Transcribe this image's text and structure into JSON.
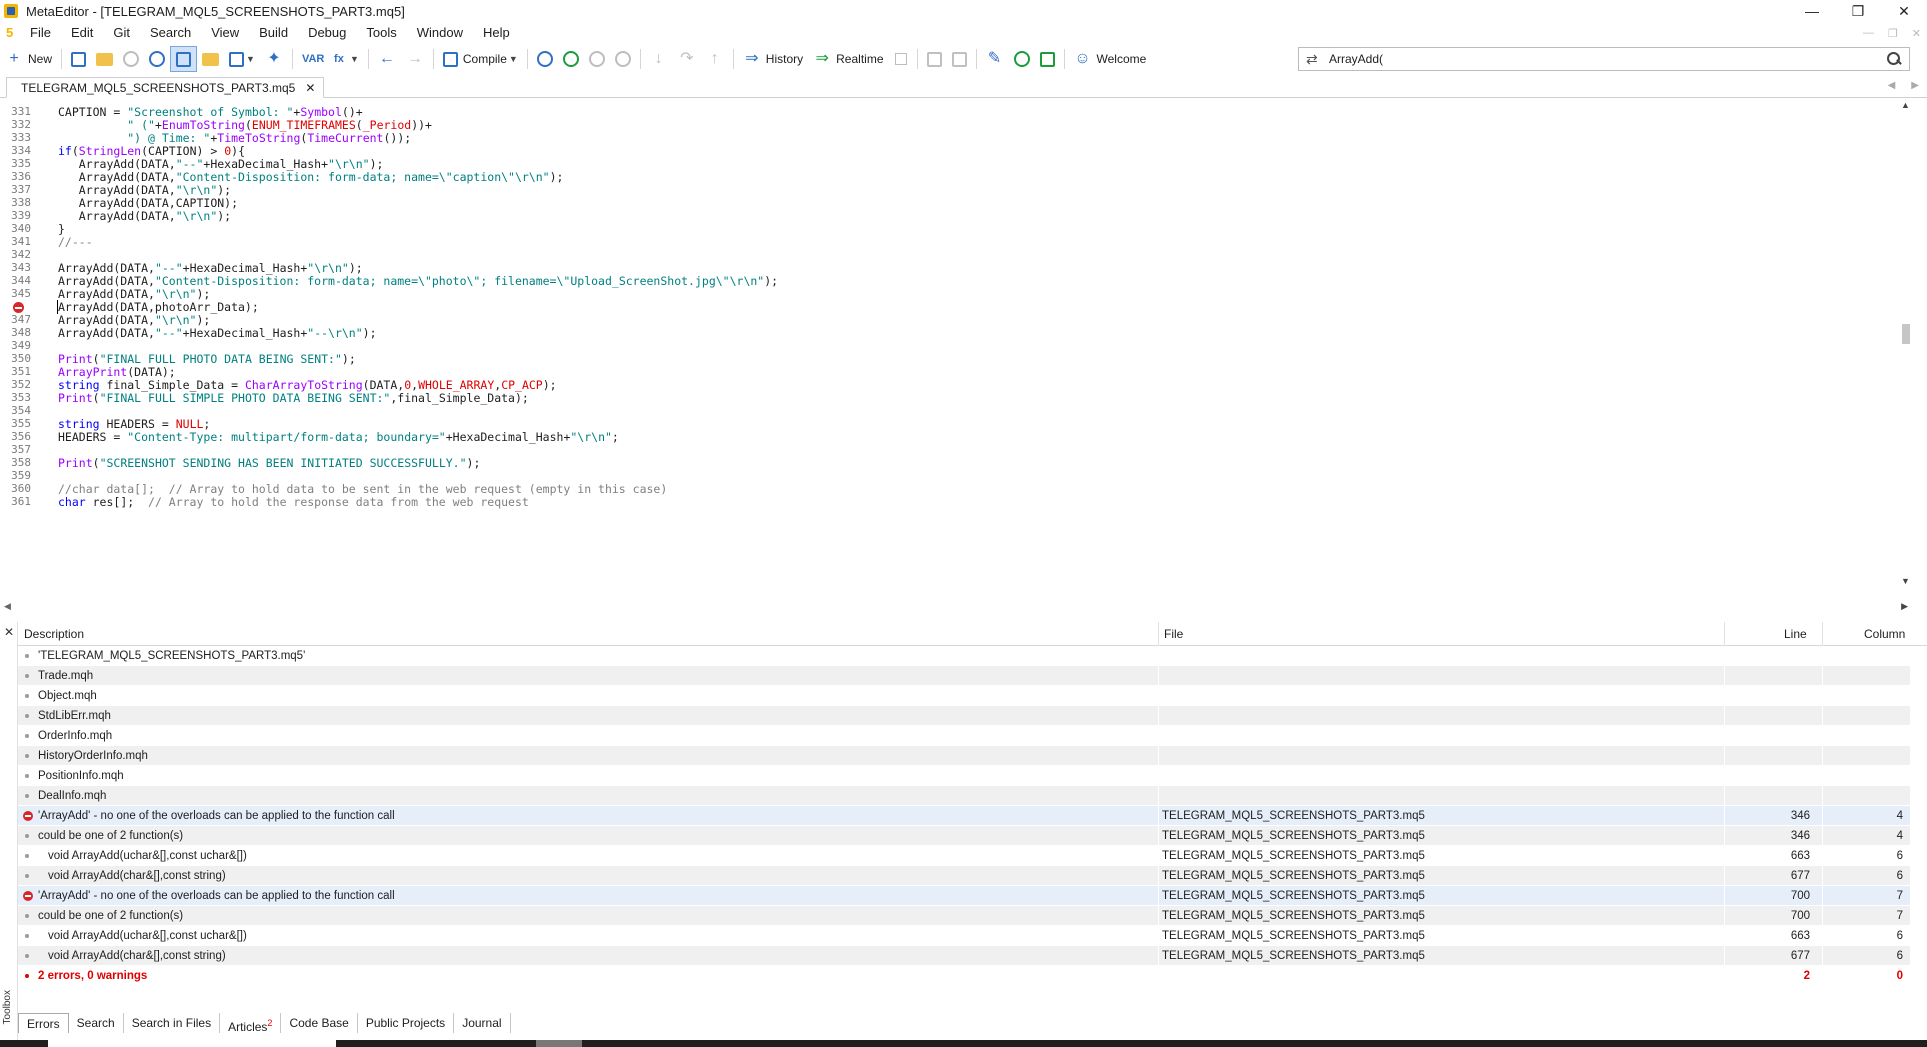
{
  "window": {
    "title": "MetaEditor - [TELEGRAM_MQL5_SCREENSHOTS_PART3.mq5]",
    "minimize": "—",
    "maximize": "❐",
    "close": "✕"
  },
  "menu": [
    "File",
    "Edit",
    "Git",
    "Search",
    "View",
    "Build",
    "Debug",
    "Tools",
    "Window",
    "Help"
  ],
  "toolbar": {
    "new_label": "New",
    "compile_label": "Compile",
    "history_label": "History",
    "realtime_label": "Realtime",
    "welcome_label": "Welcome",
    "search_value": "ArrayAdd("
  },
  "file_tab": {
    "label": "TELEGRAM_MQL5_SCREENSHOTS_PART3.mq5",
    "close": "✕"
  },
  "code_lines": [
    {
      "n": "331",
      "t": "CAPTION = \"Screenshot of Symbol: \"+Symbol()+"
    },
    {
      "n": "332",
      "t": "          \" (\"+EnumToString(ENUM_TIMEFRAMES(_Period))+"
    },
    {
      "n": "333",
      "t": "          \") @ Time: \"+TimeToString(TimeCurrent());"
    },
    {
      "n": "334",
      "t": "if(StringLen(CAPTION) > 0){"
    },
    {
      "n": "335",
      "t": "   ArrayAdd(DATA,\"--\"+HexaDecimal_Hash+\"\\r\\n\");"
    },
    {
      "n": "336",
      "t": "   ArrayAdd(DATA,\"Content-Disposition: form-data; name=\\\"caption\\\"\\r\\n\");"
    },
    {
      "n": "337",
      "t": "   ArrayAdd(DATA,\"\\r\\n\");"
    },
    {
      "n": "338",
      "t": "   ArrayAdd(DATA,CAPTION);"
    },
    {
      "n": "339",
      "t": "   ArrayAdd(DATA,\"\\r\\n\");"
    },
    {
      "n": "340",
      "t": "}"
    },
    {
      "n": "341",
      "t": "//---"
    },
    {
      "n": "342",
      "t": ""
    },
    {
      "n": "343",
      "t": "ArrayAdd(DATA,\"--\"+HexaDecimal_Hash+\"\\r\\n\");"
    },
    {
      "n": "344",
      "t": "ArrayAdd(DATA,\"Content-Disposition: form-data; name=\\\"photo\\\"; filename=\\\"Upload_ScreenShot.jpg\\\"\\r\\n\");"
    },
    {
      "n": "345",
      "t": "ArrayAdd(DATA,\"\\r\\n\");"
    },
    {
      "n": "",
      "t": "ArrayAdd(DATA,photoArr_Data);"
    },
    {
      "n": "347",
      "t": "ArrayAdd(DATA,\"\\r\\n\");"
    },
    {
      "n": "348",
      "t": "ArrayAdd(DATA,\"--\"+HexaDecimal_Hash+\"--\\r\\n\");"
    },
    {
      "n": "349",
      "t": ""
    },
    {
      "n": "350",
      "t": "Print(\"FINAL FULL PHOTO DATA BEING SENT:\");"
    },
    {
      "n": "351",
      "t": "ArrayPrint(DATA);"
    },
    {
      "n": "352",
      "t": "string final_Simple_Data = CharArrayToString(DATA,0,WHOLE_ARRAY,CP_ACP);"
    },
    {
      "n": "353",
      "t": "Print(\"FINAL FULL SIMPLE PHOTO DATA BEING SENT:\",final_Simple_Data);"
    },
    {
      "n": "354",
      "t": ""
    },
    {
      "n": "355",
      "t": "string HEADERS = NULL;"
    },
    {
      "n": "356",
      "t": "HEADERS = \"Content-Type: multipart/form-data; boundary=\"+HexaDecimal_Hash+\"\\r\\n\";"
    },
    {
      "n": "357",
      "t": ""
    },
    {
      "n": "358",
      "t": "Print(\"SCREENSHOT SENDING HAS BEEN INITIATED SUCCESSFULLY.\");"
    },
    {
      "n": "359",
      "t": ""
    },
    {
      "n": "360",
      "t": "//char data[];  // Array to hold data to be sent in the web request (empty in this case)"
    },
    {
      "n": "361",
      "t": "char res[];  // Array to hold the response data from the web request"
    }
  ],
  "errors_panel": {
    "headers": {
      "description": "Description",
      "file": "File",
      "line": "Line",
      "column": "Column"
    },
    "rows": [
      {
        "type": "info",
        "desc": "'TELEGRAM_MQL5_SCREENSHOTS_PART3.mq5'",
        "file": "",
        "line": "",
        "col": ""
      },
      {
        "type": "info",
        "desc": "Trade.mqh",
        "file": "",
        "line": "",
        "col": ""
      },
      {
        "type": "info",
        "desc": "Object.mqh",
        "file": "",
        "line": "",
        "col": ""
      },
      {
        "type": "info",
        "desc": "StdLibErr.mqh",
        "file": "",
        "line": "",
        "col": ""
      },
      {
        "type": "info",
        "desc": "OrderInfo.mqh",
        "file": "",
        "line": "",
        "col": ""
      },
      {
        "type": "info",
        "desc": "HistoryOrderInfo.mqh",
        "file": "",
        "line": "",
        "col": ""
      },
      {
        "type": "info",
        "desc": "PositionInfo.mqh",
        "file": "",
        "line": "",
        "col": ""
      },
      {
        "type": "info",
        "desc": "DealInfo.mqh",
        "file": "",
        "line": "",
        "col": ""
      },
      {
        "type": "error",
        "desc": "'ArrayAdd' - no one of the overloads can be applied to the function call",
        "file": "TELEGRAM_MQL5_SCREENSHOTS_PART3.mq5",
        "line": "346",
        "col": "4"
      },
      {
        "type": "info",
        "desc": "could be one of 2 function(s)",
        "file": "TELEGRAM_MQL5_SCREENSHOTS_PART3.mq5",
        "line": "346",
        "col": "4"
      },
      {
        "type": "sub",
        "desc": "void ArrayAdd(uchar&[],const uchar&[])",
        "file": "TELEGRAM_MQL5_SCREENSHOTS_PART3.mq5",
        "line": "663",
        "col": "6"
      },
      {
        "type": "sub",
        "desc": "void ArrayAdd(char&[],const string)",
        "file": "TELEGRAM_MQL5_SCREENSHOTS_PART3.mq5",
        "line": "677",
        "col": "6"
      },
      {
        "type": "error",
        "desc": "'ArrayAdd' - no one of the overloads can be applied to the function call",
        "file": "TELEGRAM_MQL5_SCREENSHOTS_PART3.mq5",
        "line": "700",
        "col": "7"
      },
      {
        "type": "info",
        "desc": "could be one of 2 function(s)",
        "file": "TELEGRAM_MQL5_SCREENSHOTS_PART3.mq5",
        "line": "700",
        "col": "7"
      },
      {
        "type": "sub",
        "desc": "void ArrayAdd(uchar&[],const uchar&[])",
        "file": "TELEGRAM_MQL5_SCREENSHOTS_PART3.mq5",
        "line": "663",
        "col": "6"
      },
      {
        "type": "sub",
        "desc": "void ArrayAdd(char&[],const string)",
        "file": "TELEGRAM_MQL5_SCREENSHOTS_PART3.mq5",
        "line": "677",
        "col": "6"
      },
      {
        "type": "summary",
        "desc": "2 errors, 0 warnings",
        "file": "",
        "line": "2",
        "col": "0"
      }
    ]
  },
  "toolbox_label": "Toolbox",
  "bottom_tabs": [
    {
      "label": "Errors",
      "badge": ""
    },
    {
      "label": "Search",
      "badge": ""
    },
    {
      "label": "Search in Files",
      "badge": ""
    },
    {
      "label": "Articles",
      "badge": "2"
    },
    {
      "label": "Code Base",
      "badge": ""
    },
    {
      "label": "Public Projects",
      "badge": ""
    },
    {
      "label": "Journal",
      "badge": ""
    }
  ],
  "colors": {
    "keyword": "#0000ff",
    "function": "#9b00ff",
    "constant": "#e00000",
    "string": "#008080",
    "comment": "#808080",
    "error": "#d62828"
  }
}
